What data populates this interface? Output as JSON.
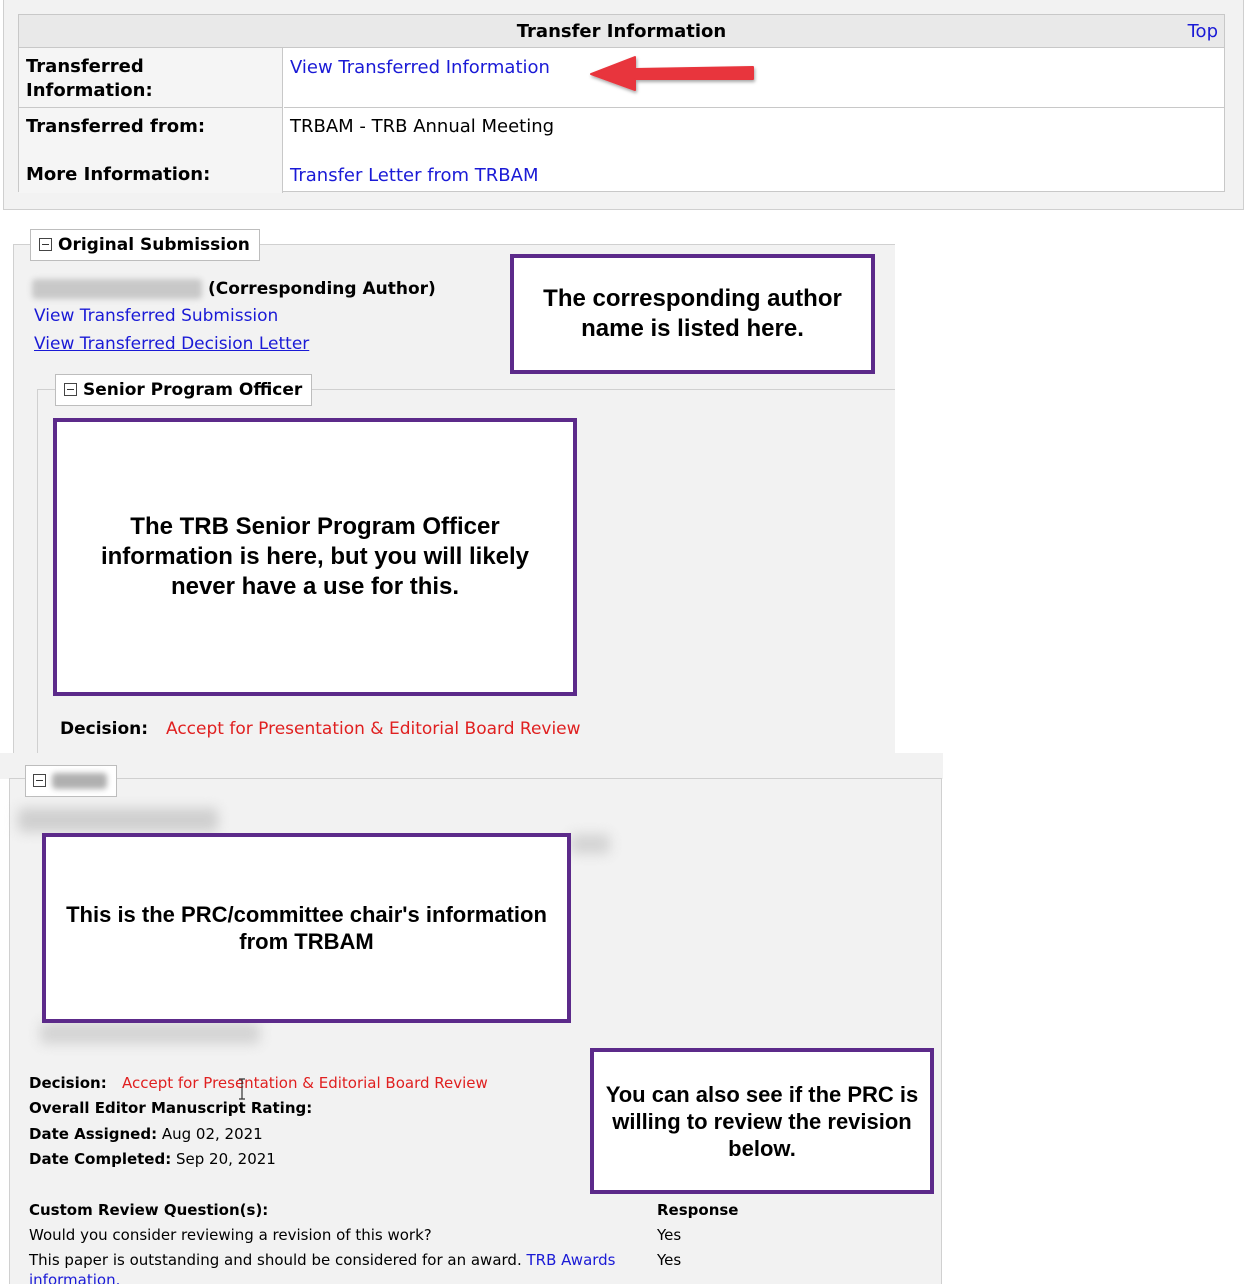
{
  "transfer_info": {
    "title": "Transfer Information",
    "top_link": "Top",
    "rows": [
      {
        "label": "Transferred Information:",
        "value": "View Transferred Information"
      },
      {
        "label": "Transferred from:",
        "value": "TRBAM - TRB Annual Meeting"
      },
      {
        "label": "More Information:",
        "value": "Transfer Letter from TRBAM"
      }
    ]
  },
  "original_submission": {
    "legend": "Original Submission",
    "author_role": "(Corresponding Author)",
    "view_submission": "View Transferred Submission",
    "view_decision_letter": "View Transferred Decision Letter",
    "spo_legend": "Senior Program Officer",
    "decision_label": "Decision:",
    "decision_value": "Accept for Presentation & Editorial Board Review"
  },
  "prc_section": {
    "decision_label": "Decision:",
    "decision_value": "Accept for Presentation & Editorial Board Review",
    "rating_label": "Overall Editor Manuscript Rating:",
    "date_assigned_label": "Date Assigned:",
    "date_assigned_value": "Aug 02, 2021",
    "date_completed_label": "Date Completed:",
    "date_completed_value": "Sep 20, 2021",
    "custom_questions_header": "Custom Review Question(s):",
    "response_header": "Response",
    "questions": [
      {
        "text": "Would you consider reviewing a revision of this work?",
        "link": "",
        "response": "Yes"
      },
      {
        "text": "This paper is outstanding and should be considered for an award.",
        "link": "TRB Awards information.",
        "response": "Yes"
      }
    ]
  },
  "callouts": {
    "author": "The corresponding author name is listed here.",
    "spo": "The TRB Senior Program Officer information is here, but you will likely never have a use for this.",
    "prc": "This is the PRC/committee chair's information from TRBAM",
    "revision": "You can also see if the PRC is willing to review the revision below."
  },
  "colors": {
    "link": "#1a1ad6",
    "decision_red": "#e02020",
    "callout_border": "#5c2a8a",
    "arrow_red": "#e8343c"
  },
  "icons": [
    "collapse-minus-icon",
    "red-arrow-icon",
    "text-cursor-icon"
  ]
}
